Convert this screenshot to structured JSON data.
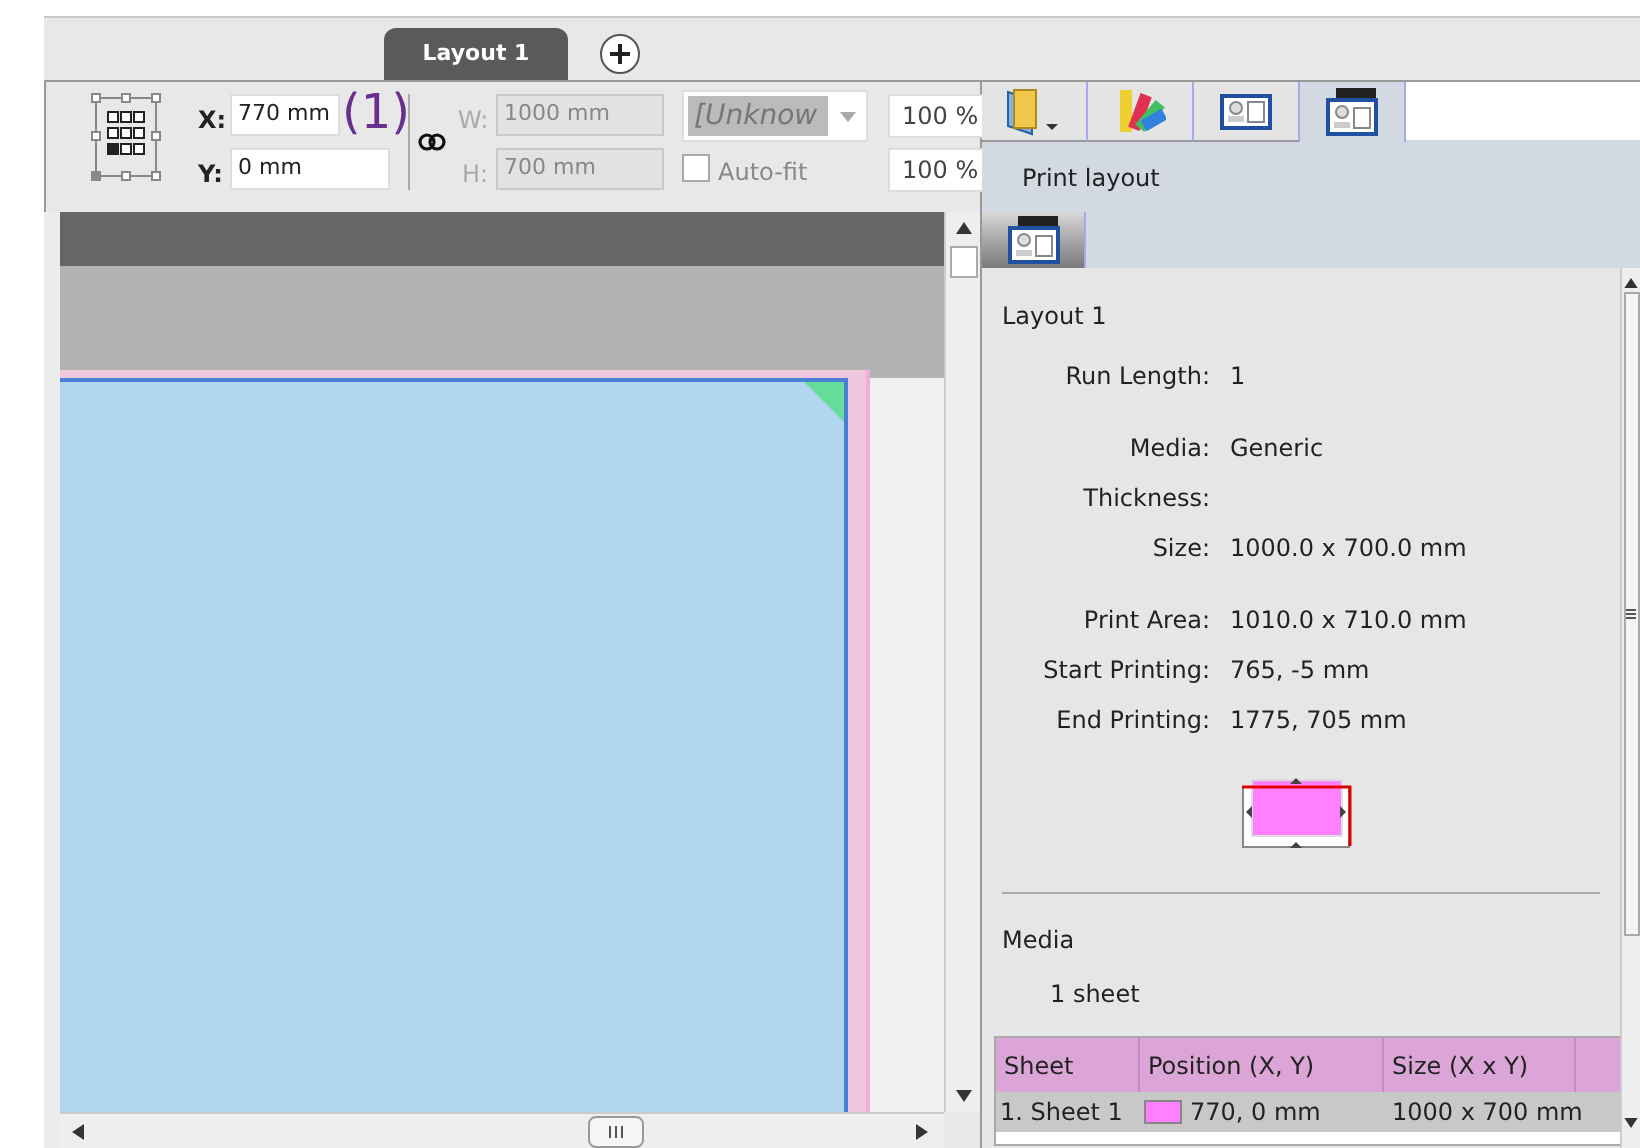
{
  "document_tabs": [
    {
      "label": "Layout 1",
      "selected": true
    }
  ],
  "toolbar": {
    "x": {
      "label": "X:",
      "value": "770 mm"
    },
    "annotation": "(1)",
    "y": {
      "label": "Y:",
      "value": "0 mm"
    },
    "w": {
      "label": "W:",
      "value": "1000 mm",
      "disabled": true
    },
    "h": {
      "label": "H:",
      "value": "700 mm",
      "disabled": true
    },
    "dropdown": {
      "value": "[Unknow",
      "disabled": true
    },
    "auto_fit": {
      "label": "Auto-fit",
      "checked": false
    },
    "scales": [
      "100 %",
      "100 %"
    ]
  },
  "panel_tabs": [
    {
      "kind": "folder",
      "selected": false
    },
    {
      "kind": "swatches",
      "selected": false
    },
    {
      "kind": "card",
      "selected": false
    },
    {
      "kind": "printer",
      "selected": true
    }
  ],
  "panel": {
    "title": "Print layout",
    "subtabs": [
      {
        "kind": "printer",
        "selected": true
      }
    ],
    "section_title": "Layout 1",
    "groups": [
      [
        {
          "label": "Run Length:",
          "value": "1"
        }
      ],
      [
        {
          "label": "Media:",
          "value": "Generic"
        },
        {
          "label": "Thickness:"
        },
        {
          "label": "Size:",
          "value": "1000.0 x 700.0 mm"
        }
      ],
      [
        {
          "label": "Print Area:",
          "value": "1010.0 x 710.0 mm"
        },
        {
          "label": "Start Printing:",
          "value": "765, -5 mm"
        },
        {
          "label": "End Printing:",
          "value": "1775, 705 mm"
        }
      ]
    ],
    "media": {
      "title": "Media",
      "count": "1 sheet",
      "table": {
        "columns": [
          "Sheet",
          "Position (X, Y)",
          "Size (X x Y)"
        ],
        "rows": [
          {
            "sheet": "1. Sheet 1",
            "color": "#ff80ff",
            "position": "770, 0 mm",
            "size": "1000 x 700 mm",
            "selected": true
          }
        ]
      }
    }
  }
}
